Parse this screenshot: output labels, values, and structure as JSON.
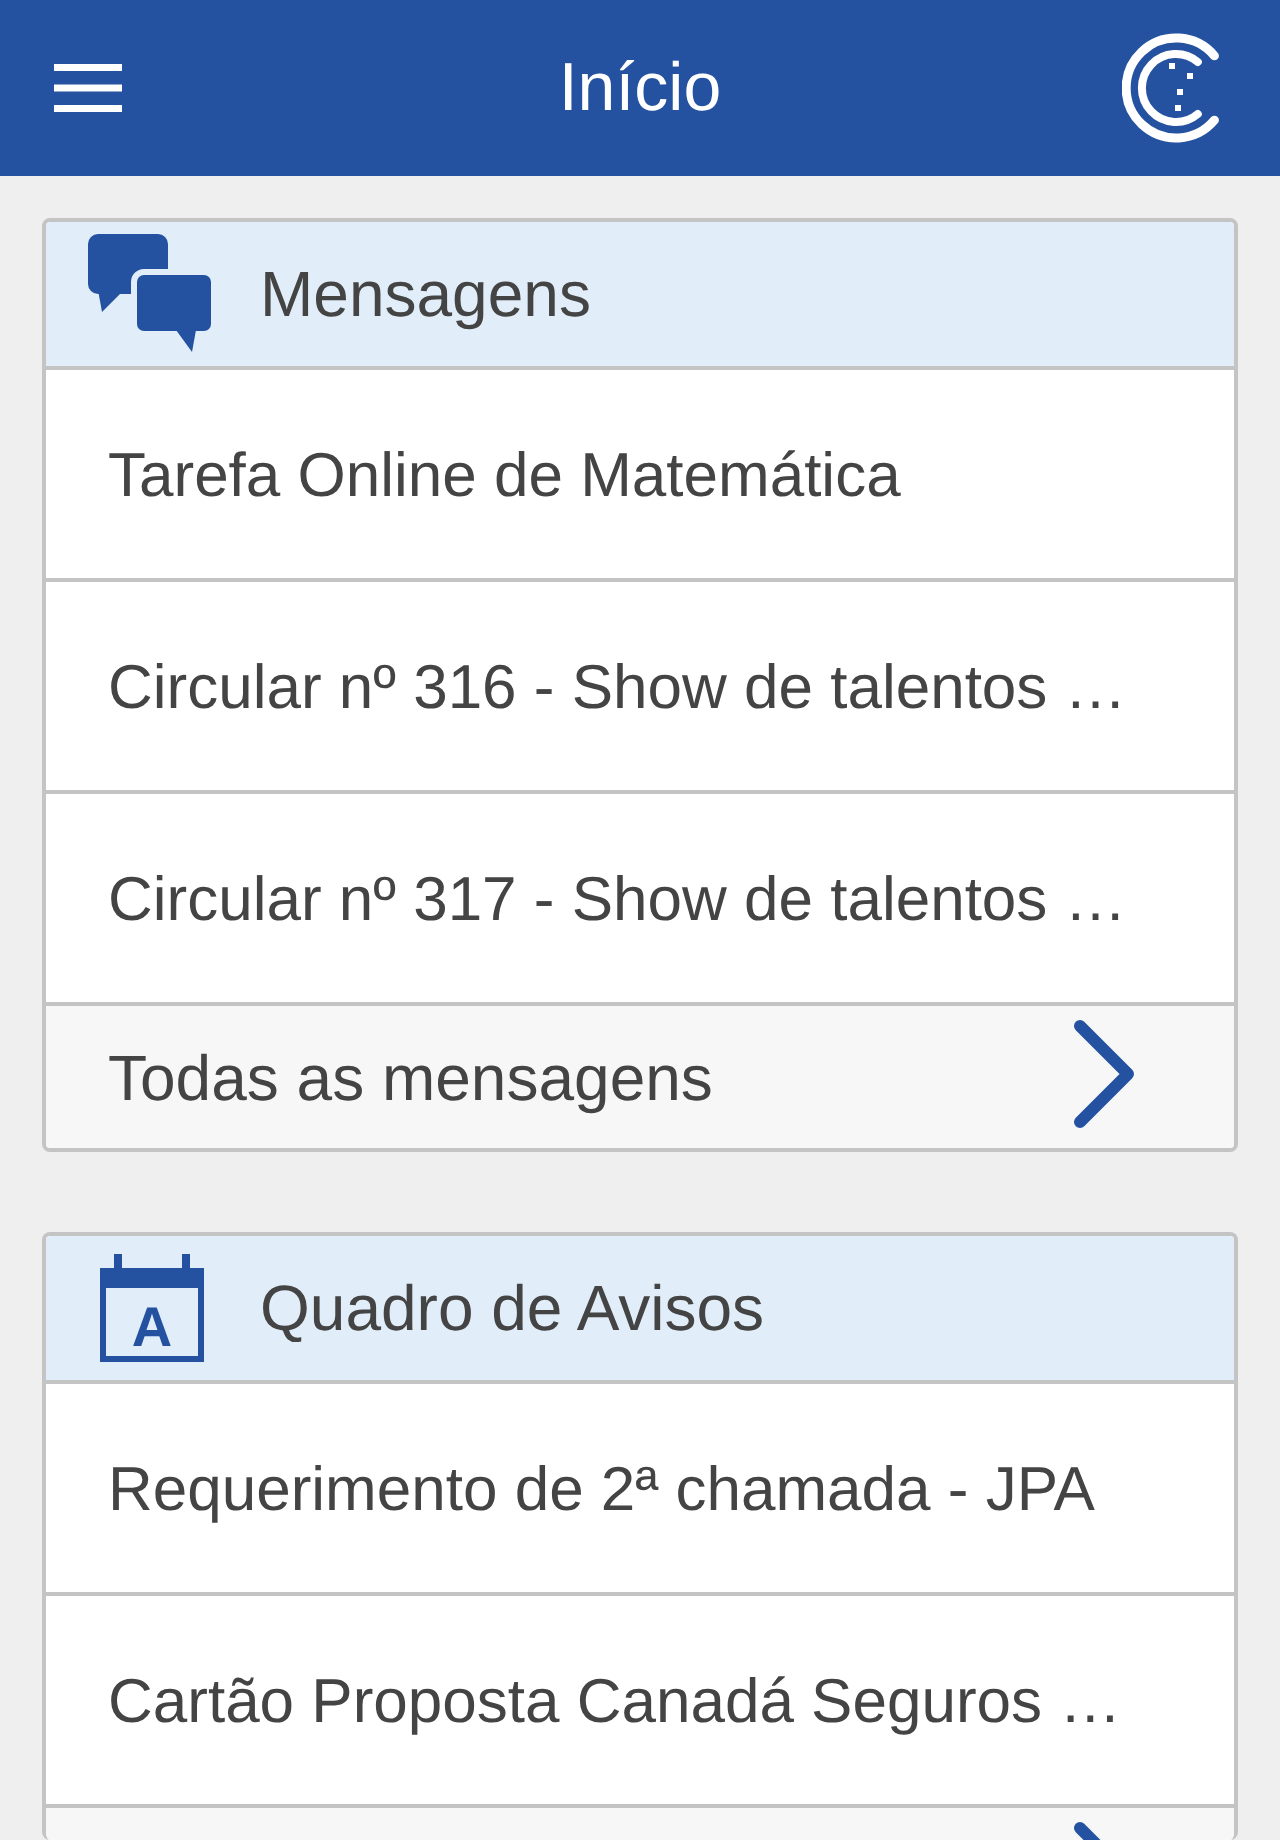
{
  "header": {
    "title": "Início"
  },
  "sections": [
    {
      "kind": "messages",
      "title": "Mensagens",
      "items": [
        "Tarefa Online de Matemática",
        "Circular nº 316 - Show de talentos …",
        "Circular nº 317 - Show de talentos …"
      ],
      "footer_label": "Todas as mensagens"
    },
    {
      "kind": "notices",
      "title": "Quadro de Avisos",
      "icon_letter": "A",
      "items": [
        "Requerimento de 2ª chamada - JPA",
        "Cartão Proposta Canadá Seguros …"
      ]
    }
  ]
}
